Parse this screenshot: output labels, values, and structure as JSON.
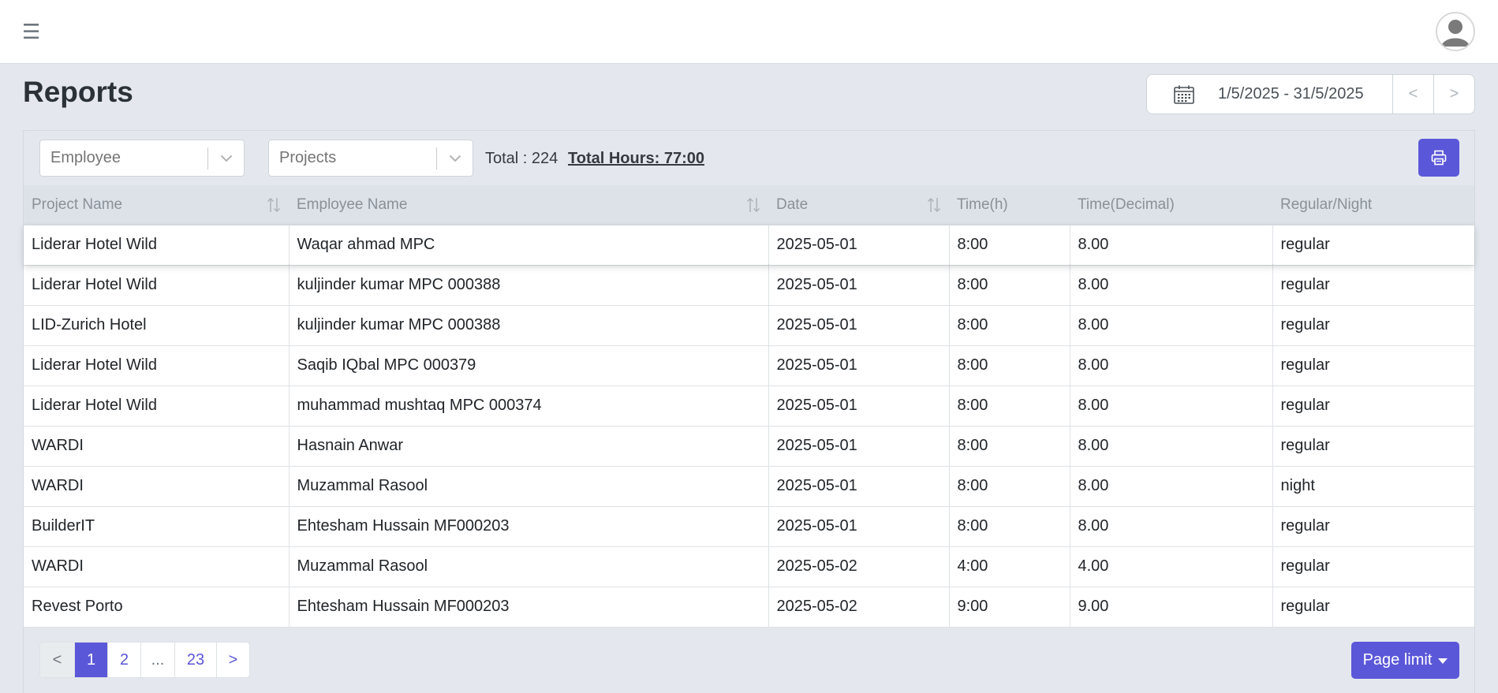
{
  "header": {
    "menu_icon": "hamburger-icon",
    "menu_glyph": "☰",
    "avatar_icon": "user-avatar-icon"
  },
  "page": {
    "title": "Reports"
  },
  "date_range": {
    "icon": "calendar-icon",
    "value": "1/5/2025 - 31/5/2025",
    "prev_label": "<",
    "next_label": ">"
  },
  "filters": {
    "employee_placeholder": "Employee",
    "projects_placeholder": "Projects",
    "total_text": "Total : 224",
    "total_hours_text": "Total Hours: 77:00",
    "print_icon": "printer-icon"
  },
  "table": {
    "columns": [
      "Project Name",
      "Employee Name",
      "Date",
      "Time(h)",
      "Time(Decimal)",
      "Regular/Night"
    ],
    "sortable": [
      true,
      true,
      true,
      false,
      false,
      false
    ],
    "rows": [
      [
        "Liderar Hotel Wild",
        "Waqar ahmad MPC",
        "2025-05-01",
        "8:00",
        "8.00",
        "regular"
      ],
      [
        "Liderar Hotel Wild",
        "kuljinder kumar MPC 000388",
        "2025-05-01",
        "8:00",
        "8.00",
        "regular"
      ],
      [
        "LID-Zurich Hotel",
        "kuljinder kumar MPC 000388",
        "2025-05-01",
        "8:00",
        "8.00",
        "regular"
      ],
      [
        "Liderar Hotel Wild",
        "Saqib IQbal MPC 000379",
        "2025-05-01",
        "8:00",
        "8.00",
        "regular"
      ],
      [
        "Liderar Hotel Wild",
        "muhammad mushtaq MPC 000374",
        "2025-05-01",
        "8:00",
        "8.00",
        "regular"
      ],
      [
        "WARDI",
        "Hasnain Anwar",
        "2025-05-01",
        "8:00",
        "8.00",
        "regular"
      ],
      [
        "WARDI",
        "Muzammal Rasool",
        "2025-05-01",
        "8:00",
        "8.00",
        "night"
      ],
      [
        "BuilderIT",
        "Ehtesham Hussain MF000203",
        "2025-05-01",
        "8:00",
        "8.00",
        "regular"
      ],
      [
        "WARDI",
        "Muzammal Rasool",
        "2025-05-02",
        "4:00",
        "4.00",
        "regular"
      ],
      [
        "Revest Porto",
        "Ehtesham Hussain MF000203",
        "2025-05-02",
        "9:00",
        "9.00",
        "regular"
      ]
    ]
  },
  "pagination": {
    "prev": "<",
    "pages": [
      "1",
      "2",
      "...",
      "23"
    ],
    "active_page": "1",
    "next": ">"
  },
  "page_limit": {
    "label": "Page limit"
  },
  "colors": {
    "accent": "#5b57d9",
    "background": "#e4e8ee"
  }
}
